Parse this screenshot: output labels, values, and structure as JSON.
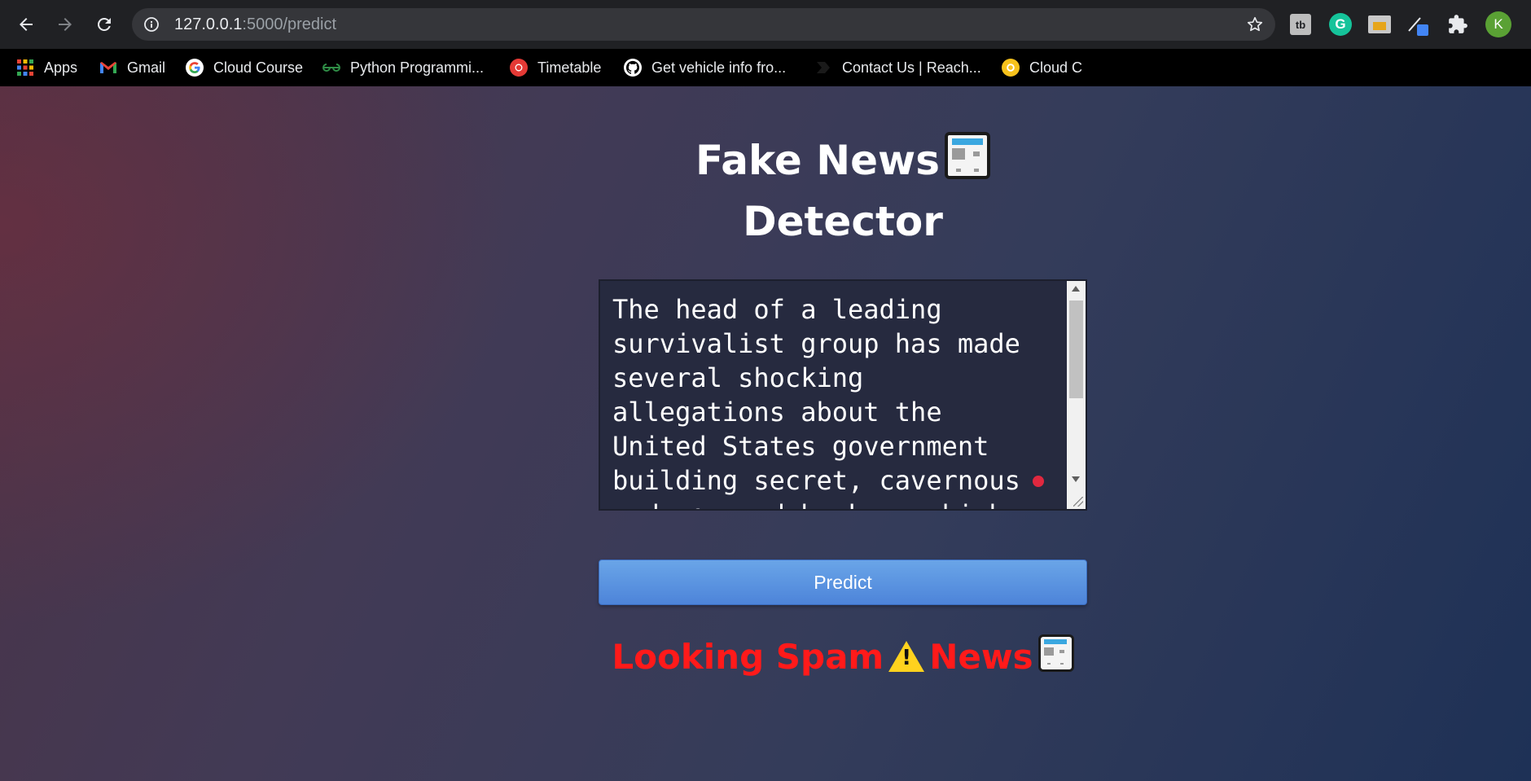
{
  "browser": {
    "url_host": "127.0.0.1",
    "url_path": ":5000/predict",
    "avatar_letter": "K",
    "extensions": {
      "tb_label": "tb",
      "grammarly_label": "G"
    }
  },
  "bookmarks": [
    {
      "label": "Apps",
      "icon": "apps-grid-icon"
    },
    {
      "label": "Gmail",
      "icon": "gmail-icon"
    },
    {
      "label": "Cloud Course",
      "icon": "google-icon"
    },
    {
      "label": "Python Programmi...",
      "icon": "geeksforgeeks-icon"
    },
    {
      "label": "Timetable",
      "icon": "timetable-icon"
    },
    {
      "label": "Get vehicle info fro...",
      "icon": "github-icon"
    },
    {
      "label": "Contact Us | Reach...",
      "icon": "contact-icon"
    },
    {
      "label": "Cloud C",
      "icon": "cloud-icon"
    }
  ],
  "page": {
    "title_line1": "Fake News",
    "title_line2": "Detector",
    "news_text": "The head of a leading\nsurvivalist group has made\nseveral shocking\nallegations about the\nUnited States government\nbuilding secret, cavernous\nunderground bunkers which",
    "predict_label": "Predict",
    "result_word1": "Looking Spam",
    "result_word2": "News"
  },
  "colors": {
    "result_text": "#ff1a1a",
    "predict_button": "#5a92e0",
    "page_gradient_start": "#4b3347",
    "page_gradient_end": "#1e3156"
  }
}
